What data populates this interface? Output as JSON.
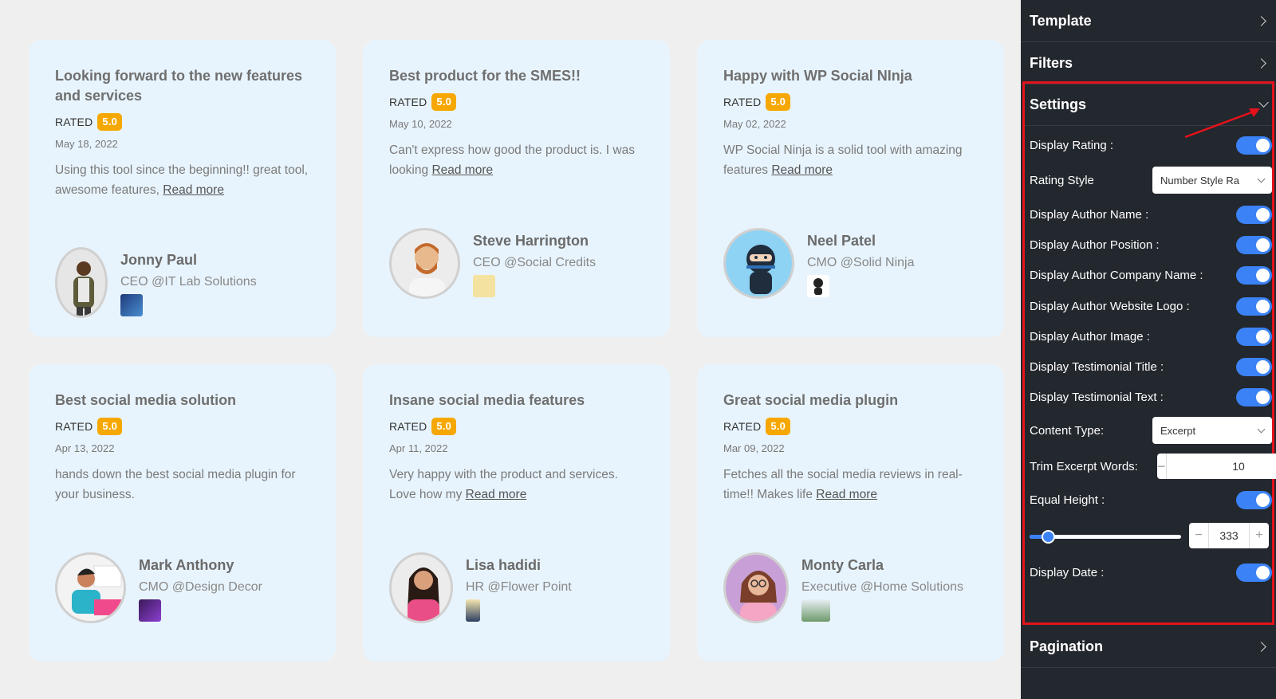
{
  "read_more_label": "Read more",
  "cards": [
    {
      "title": "Looking forward to the new features and services",
      "rated": "RATED",
      "rating": "5.0",
      "date": "May 18, 2022",
      "text": "Using this tool since the beginning!! great tool, awesome features,",
      "name": "Jonny Paul",
      "position": "CEO @IT Lab Solutions"
    },
    {
      "title": "Best product for the SMES!!",
      "rated": "RATED",
      "rating": "5.0",
      "date": "May 10, 2022",
      "text": "Can't express how good the product is. I was looking",
      "name": "Steve Harrington",
      "position": "CEO @Social Credits"
    },
    {
      "title": "Happy with WP Social NInja",
      "rated": "RATED",
      "rating": "5.0",
      "date": "May 02, 2022",
      "text": "WP Social Ninja is a solid tool with amazing features",
      "name": "Neel Patel",
      "position": "CMO @Solid Ninja"
    },
    {
      "title": "Best social media solution",
      "rated": "RATED",
      "rating": "5.0",
      "date": "Apr 13, 2022",
      "text": "hands down the best social media plugin for your business.",
      "name": "Mark Anthony",
      "position": "CMO @Design Decor"
    },
    {
      "title": "Insane social media features",
      "rated": "RATED",
      "rating": "5.0",
      "date": "Apr 11, 2022",
      "text": "Very happy with the product and services. Love how my",
      "name": "Lisa hadidi",
      "position": "HR @Flower Point"
    },
    {
      "title": "Great social media plugin",
      "rated": "RATED",
      "rating": "5.0",
      "date": "Mar 09, 2022",
      "text": "Fetches all the social media reviews in real-time!! Makes life",
      "name": "Monty Carla",
      "position": "Executive @Home Solutions"
    }
  ],
  "panel": {
    "template": "Template",
    "filters": "Filters",
    "settings": "Settings",
    "pagination": "Pagination",
    "display_rating": "Display Rating :",
    "rating_style": "Rating Style",
    "rating_style_value": "Number Style Ra",
    "display_author_name": "Display Author Name :",
    "display_author_position": "Display Author Position :",
    "display_author_company": "Display Author Company Name :",
    "display_author_logo": "Display Author Website Logo :",
    "display_author_image": "Display Author Image :",
    "display_title": "Display Testimonial Title :",
    "display_text": "Display Testimonial Text :",
    "content_type": "Content Type:",
    "content_type_value": "Excerpt",
    "trim_words": "Trim Excerpt Words:",
    "trim_words_value": "10",
    "equal_height": "Equal Height :",
    "height_value": "333",
    "height_level": 0.12,
    "display_date": "Display Date :",
    "minus": "−",
    "plus": "+"
  },
  "colors": {
    "accent": "#3b82f6",
    "badge": "#f6a700",
    "highlight": "#e3121b",
    "panel": "#23272e"
  }
}
